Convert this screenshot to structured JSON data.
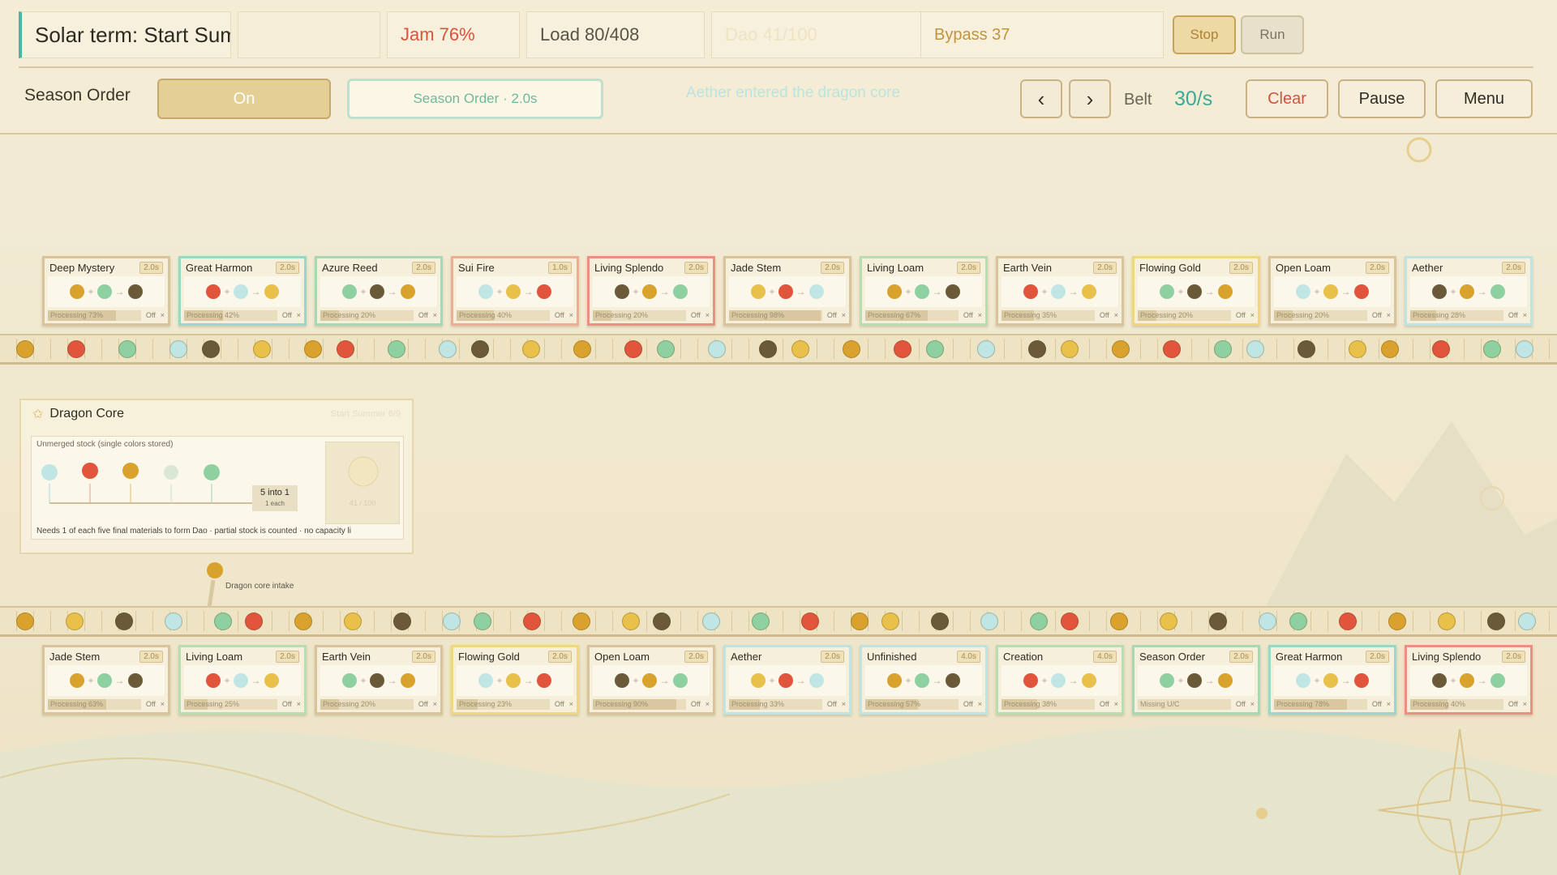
{
  "hud": {
    "title": "Solar term: Start Summer (Stage...",
    "jam": "Jam 76%",
    "load": "Load 80/408",
    "dao": "Dao 41/100",
    "bypass": "Bypass 37",
    "stop": "Stop",
    "run": "Run",
    "season_order_label": "Season Order",
    "on": "On",
    "season_order_btn": "Season Order · 2.0s",
    "toast": "Aether entered the dragon core",
    "prev": "‹",
    "next": "›",
    "belt_label": "Belt",
    "belt_value": "30/s",
    "clear": "Clear",
    "pause": "Pause",
    "menu": "Menu"
  },
  "top_cards": [
    {
      "name": "Deep Mystery",
      "time": "2.0s",
      "proc": "Processing 73%",
      "pct": 73,
      "color": "#d8c49a",
      "off": "Off",
      "x": "×"
    },
    {
      "name": "Great Harmon",
      "time": "2.0s",
      "proc": "Processing 42%",
      "pct": 42,
      "color": "#9fd5c9",
      "off": "Off",
      "x": "×"
    },
    {
      "name": "Azure Reed",
      "time": "2.0s",
      "proc": "Processing 20%",
      "pct": 20,
      "color": "#a8d8b3",
      "off": "Off",
      "x": "×"
    },
    {
      "name": "Sui Fire",
      "time": "1.0s",
      "proc": "Processing 40%",
      "pct": 40,
      "color": "#ecae93",
      "off": "Off",
      "x": "×"
    },
    {
      "name": "Living Splendo",
      "time": "2.0s",
      "proc": "Processing 20%",
      "pct": 20,
      "color": "#ea9080",
      "off": "Off",
      "x": "×"
    },
    {
      "name": "Jade Stem",
      "time": "2.0s",
      "proc": "Processing 98%",
      "pct": 98,
      "color": "#d8c49a",
      "off": "Off",
      "x": "×"
    },
    {
      "name": "Living Loam",
      "time": "2.0s",
      "proc": "Processing 67%",
      "pct": 67,
      "color": "#b9dcb1",
      "off": "Off",
      "x": "×"
    },
    {
      "name": "Earth Vein",
      "time": "2.0s",
      "proc": "Processing 35%",
      "pct": 35,
      "color": "#d8c49a",
      "off": "Off",
      "x": "×"
    },
    {
      "name": "Flowing Gold",
      "time": "2.0s",
      "proc": "Processing 20%",
      "pct": 20,
      "color": "#f0d586",
      "off": "Off",
      "x": "×"
    },
    {
      "name": "Open Loam",
      "time": "2.0s",
      "proc": "Processing 20%",
      "pct": 20,
      "color": "#d8c49a",
      "off": "Off",
      "x": "×"
    },
    {
      "name": "Aether",
      "time": "2.0s",
      "proc": "Processing 28%",
      "pct": 28,
      "color": "#bfe3de",
      "off": "Off",
      "x": "×"
    }
  ],
  "bottom_cards": [
    {
      "name": "Jade Stem",
      "time": "2.0s",
      "proc": "Processing 63%",
      "pct": 63,
      "color": "#d8c49a",
      "off": "Off",
      "x": "×"
    },
    {
      "name": "Living Loam",
      "time": "2.0s",
      "proc": "Processing 25%",
      "pct": 25,
      "color": "#b9dcb1",
      "off": "Off",
      "x": "×"
    },
    {
      "name": "Earth Vein",
      "time": "2.0s",
      "proc": "Processing 20%",
      "pct": 20,
      "color": "#d8c49a",
      "off": "Off",
      "x": "×"
    },
    {
      "name": "Flowing Gold",
      "time": "2.0s",
      "proc": "Processing 23%",
      "pct": 23,
      "color": "#f0d586",
      "off": "Off",
      "x": "×"
    },
    {
      "name": "Open Loam",
      "time": "2.0s",
      "proc": "Processing 90%",
      "pct": 90,
      "color": "#d8c49a",
      "off": "Off",
      "x": "×"
    },
    {
      "name": "Aether",
      "time": "2.0s",
      "proc": "Processing 33%",
      "pct": 33,
      "color": "#bfe3de",
      "off": "Off",
      "x": "×"
    },
    {
      "name": "Unfinished",
      "time": "4.0s",
      "proc": "Processing 57%",
      "pct": 57,
      "color": "#bfe3de",
      "off": "Off",
      "x": "×"
    },
    {
      "name": "Creation",
      "time": "4.0s",
      "proc": "Processing 38%",
      "pct": 38,
      "color": "#b9dcb1",
      "off": "Off",
      "x": "×"
    },
    {
      "name": "Season Order",
      "time": "2.0s",
      "proc": "Missing U/C",
      "pct": 0,
      "color": "#a8d8b3",
      "off": "Off",
      "x": "×"
    },
    {
      "name": "Great Harmon",
      "time": "2.0s",
      "proc": "Processing 78%",
      "pct": 78,
      "color": "#9fd5c9",
      "off": "Off",
      "x": "×"
    },
    {
      "name": "Living Splendo",
      "time": "2.0s",
      "proc": "Processing 40%",
      "pct": 40,
      "color": "#ea9080",
      "off": "Off",
      "x": "×"
    }
  ],
  "core": {
    "title": "Dragon Core",
    "stage": "Start Summer 6/9",
    "subtitle": "Unmerged stock (single colors stored)",
    "into": "5 into 1",
    "into_sub": "1 each",
    "out": "41 / 100",
    "note": "Needs 1 of each five final materials to form Dao · partial stock is counted · no capacity li",
    "intake": "Dragon core intake"
  },
  "colors": {
    "accent_teal": "#3ea997",
    "jam_red": "#d9533d",
    "gold": "#c0943a"
  }
}
